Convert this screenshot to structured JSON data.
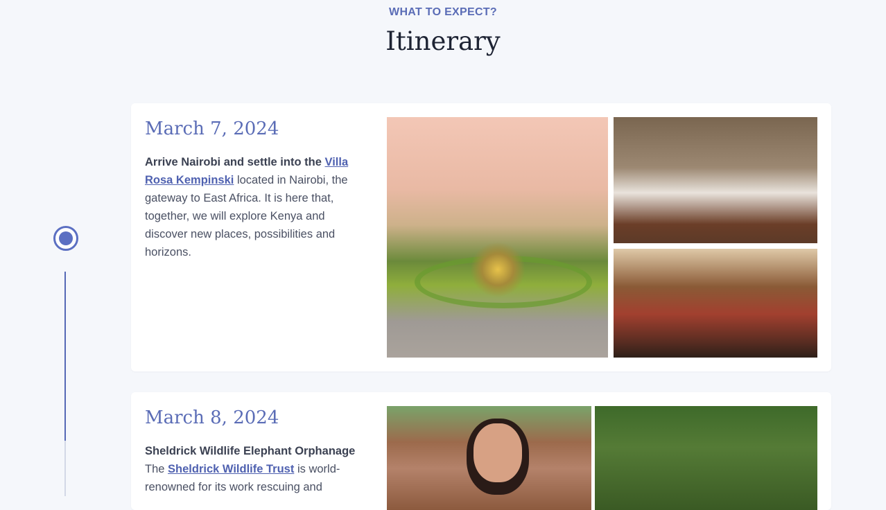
{
  "header": {
    "eyebrow": "WHAT TO EXPECT?",
    "title": "Itinerary"
  },
  "itinerary": [
    {
      "date": "March 7, 2024",
      "intro_bold": "Arrive Nairobi and settle into the",
      "link_text": "Villa Rosa Kempinski",
      "body": "located in Nairobi, the gateway to East Africa. It is here that, together, we will explore Kenya and discover new places, possibilities and horizons.",
      "photos": [
        "hotel-courtyard-fountain-photo",
        "hotel-bedroom-photo",
        "hotel-lounge-photo"
      ]
    },
    {
      "date": "March 8, 2024",
      "intro_bold": "Sheldrick Wildlife Elephant Orphanage",
      "body_prefix": "The",
      "link_text": "Sheldrick Wildlife Trust",
      "body": "is world-renowned for its work rescuing and",
      "photos": [
        "woman-with-elephants-photo",
        "elephant-feeding-photo"
      ]
    }
  ],
  "colors": {
    "accent": "#5a6cb6",
    "background": "#f5f7fb",
    "card": "#ffffff",
    "text": "#4a5063",
    "heading": "#1d2333"
  }
}
